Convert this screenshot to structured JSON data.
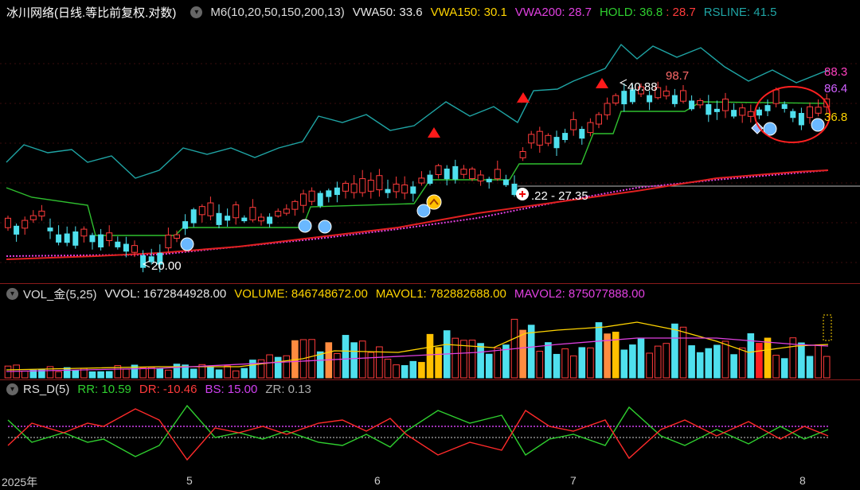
{
  "main_header": {
    "title": "冰川网络(日线.等比前复权.对数)",
    "indicator": "M6(10,20,50,150,200,13)",
    "vwa50": "VWA50: 33.6",
    "vwa150": "VWA150: 30.1",
    "vwa200": "VWA200: 28.7",
    "hold": "HOLD: 36.8",
    "hold2": ": 28.7",
    "rsline": "RSLINE: 41.5"
  },
  "vol_header": {
    "title": "VOL_金(5,25)",
    "vvol": "VVOL: 1672844928.00",
    "volume": "VOLUME: 846748672.00",
    "mavol1": "MAVOL1: 782882688.00",
    "mavol2": "MAVOL2: 875077888.00"
  },
  "rs_header": {
    "title": "RS_D(5)",
    "rr": "RR: 10.59",
    "dr": "DR: -10.46",
    "bs": "BS: 15.00",
    "zr": "ZR: 0.13"
  },
  "annotations": {
    "low": "20.00",
    "high_arrow": "40.88",
    "range": ".22 - 27.35",
    "right_top": "88.3",
    "right_peak": "98.7",
    "right_mid": "86.4",
    "right_hold": "36.8"
  },
  "x_axis": {
    "labels": [
      "2025年",
      "5",
      "6",
      "7",
      "8"
    ]
  },
  "colors": {
    "up": "#ff3b3b",
    "down": "#4fe0ee",
    "vwa50": "#3fbf3f",
    "vwa150": "#ffd400",
    "vwa200": "#e040e0",
    "hold": "#2fbf2f",
    "rsline": "#1fa5a5",
    "ma_red": "#e02020",
    "vol_orange": "#ff8c40",
    "vol_gold": "#ffc000"
  }
}
